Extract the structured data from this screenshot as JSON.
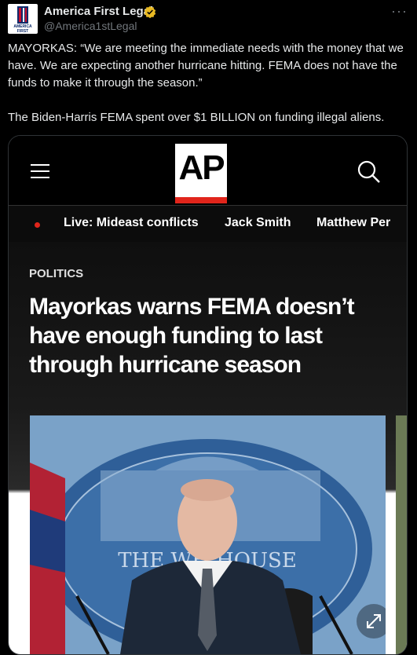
{
  "post": {
    "author_name": "America First Legal",
    "author_handle": "@America1stLegal",
    "avatar_text": "AMERICA FIRST",
    "text_para1": "MAYORKAS: “We are meeting the immediate needs with the money that we have. We are expecting another hurricane hitting. FEMA does not have the funds to make it through the season.”",
    "text_para2": "The Biden-Harris FEMA spent over $1 BILLION on funding illegal aliens.",
    "more_icon": "more-icon",
    "verified_icon": "verified-badge-icon"
  },
  "card": {
    "logo_text": "AP",
    "menu_icon": "hamburger-icon",
    "search_icon": "search-icon",
    "nav": [
      "Live: Mideast conflicts",
      "Jack Smith",
      "Matthew Per"
    ],
    "section": "POLITICS",
    "headline": "Mayorkas warns FEMA doesn’t have enough funding to last through hurricane season",
    "photo_sign_text": "THE WH HOUSE",
    "expand_icon": "expand-icon"
  },
  "colors": {
    "background": "#000000",
    "text": "#e7e9ea",
    "muted": "#71767b",
    "ap_red": "#e1251b",
    "verified_gold": "#e8b923"
  }
}
